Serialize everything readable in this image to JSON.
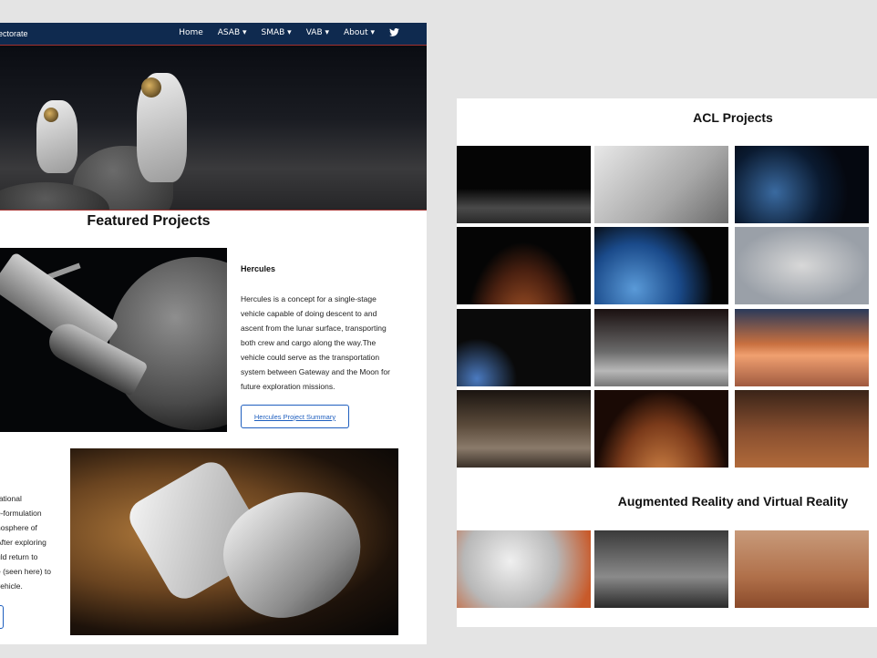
{
  "left_page": {
    "navbar": {
      "brand": "ectorate",
      "links": [
        {
          "label": "Home"
        },
        {
          "label": "ASAB ▾"
        },
        {
          "label": "SMAB ▾"
        },
        {
          "label": "VAB ▾"
        },
        {
          "label": "About ▾"
        }
      ],
      "social_icon": "twitter-icon"
    },
    "featured_title": "Featured Projects",
    "hercules": {
      "title": "Hercules",
      "description": "Hercules is a concept for a single-stage vehicle capable of doing descent to and ascent from the lunar surface, transporting both crew and cargo along the way.The vehicle could serve as the transportation system between Gateway and the Moon for future exploration missions.",
      "button": "Hercules Project Summary"
    },
    "mars_partial_text": [
      "rational",
      "e-formulation",
      "nosphere of",
      "After exploring",
      "uld return to",
      "e (seen here) to",
      "vehicle."
    ]
  },
  "right_page": {
    "acl_title": "ACL Projects",
    "ar_vr_title": "Augmented Reality and Virtual Reality"
  },
  "colors": {
    "navbar_bg": "#0f2a4f",
    "accent_red": "#a3312f",
    "button_blue": "#1f5fbf",
    "page_bg": "#e4e4e4"
  }
}
